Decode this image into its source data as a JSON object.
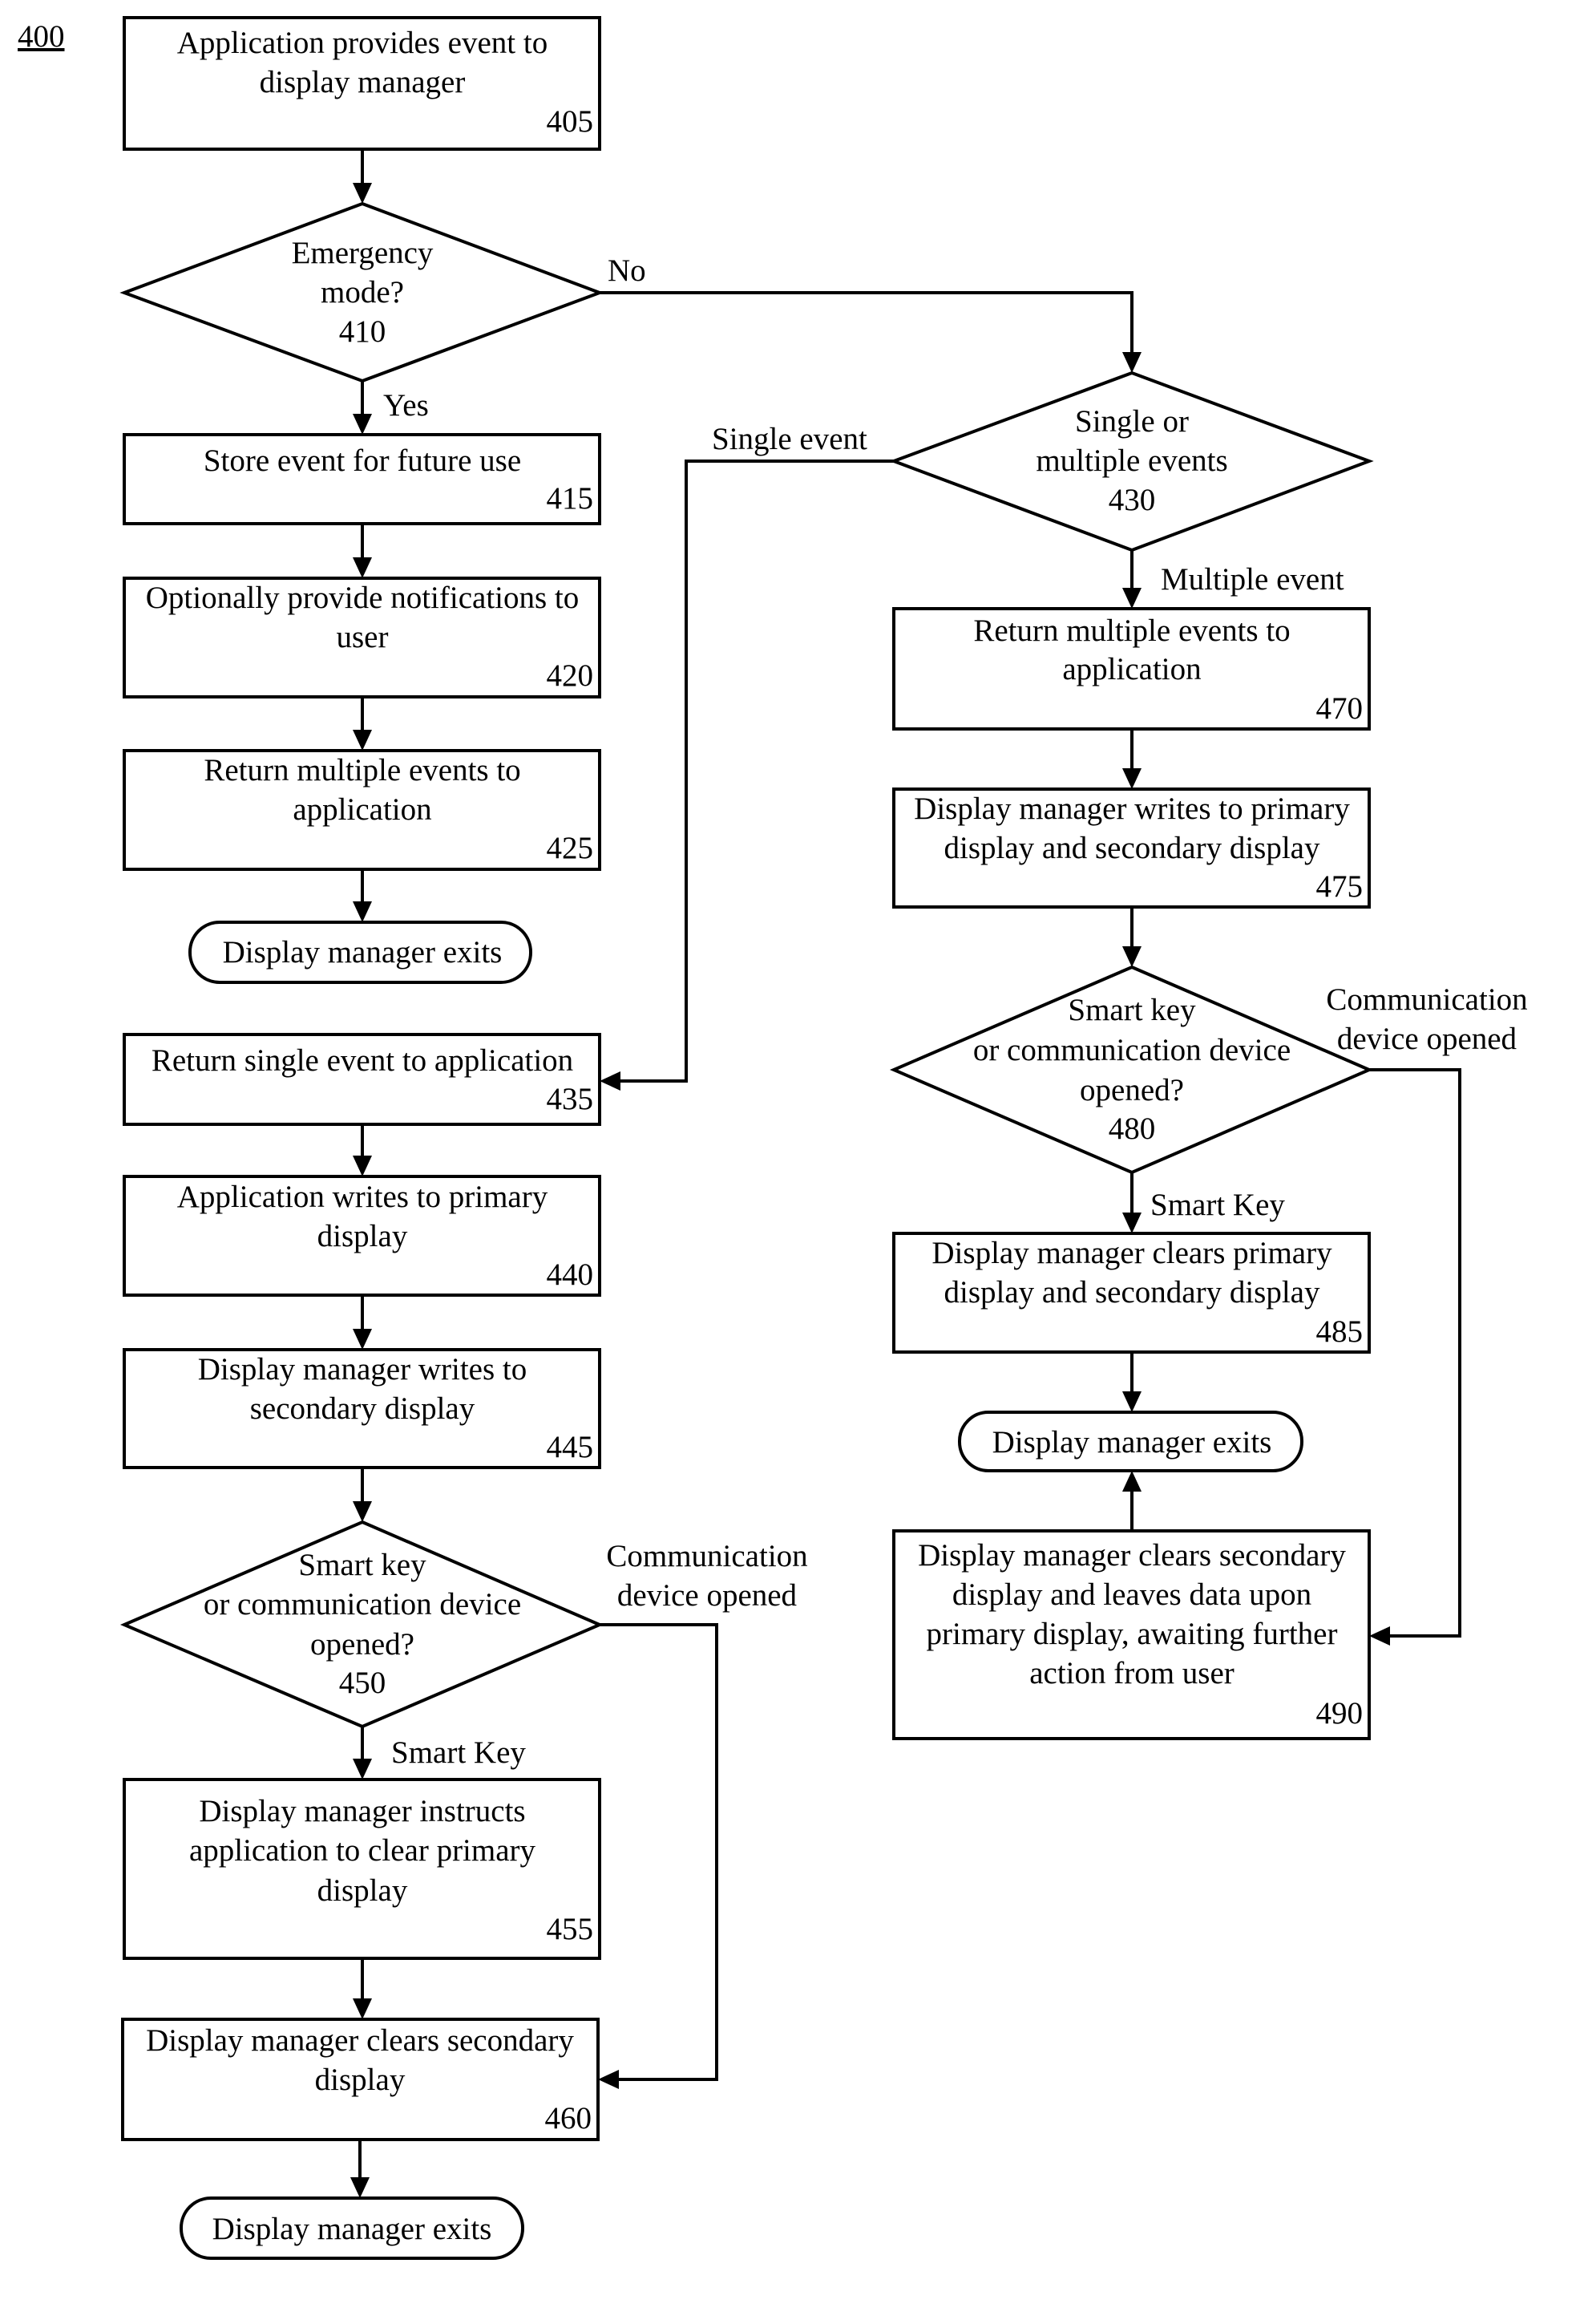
{
  "figure_label": "400",
  "nodes": {
    "n405": {
      "lines": [
        "Application provides event to",
        "display manager"
      ],
      "ref": "405"
    },
    "n410": {
      "lines": [
        "Emergency",
        "mode?"
      ],
      "ref": "410"
    },
    "n415": {
      "lines": [
        "Store event for future use"
      ],
      "ref": "415"
    },
    "n420": {
      "lines": [
        "Optionally provide notifications to",
        "user"
      ],
      "ref": "420"
    },
    "n425": {
      "lines": [
        "Return multiple events to",
        "application"
      ],
      "ref": "425"
    },
    "exit1": {
      "label": "Display manager exits"
    },
    "n435": {
      "lines": [
        "Return single event to application"
      ],
      "ref": "435"
    },
    "n440": {
      "lines": [
        "Application writes to primary",
        "display"
      ],
      "ref": "440"
    },
    "n445": {
      "lines": [
        "Display manager writes to",
        "secondary display"
      ],
      "ref": "445"
    },
    "n450": {
      "lines": [
        "Smart key",
        "or communication device",
        "opened?"
      ],
      "ref": "450"
    },
    "n455": {
      "lines": [
        "Display manager instructs",
        "application to clear primary",
        "display"
      ],
      "ref": "455"
    },
    "n460": {
      "lines": [
        "Display manager clears secondary",
        "display"
      ],
      "ref": "460"
    },
    "exit2": {
      "label": "Display manager exits"
    },
    "n430": {
      "lines": [
        "Single or",
        "multiple events"
      ],
      "ref": "430"
    },
    "n470": {
      "lines": [
        "Return multiple events to",
        "application"
      ],
      "ref": "470"
    },
    "n475": {
      "lines": [
        "Display manager writes to primary",
        "display and secondary display"
      ],
      "ref": "475"
    },
    "n480": {
      "lines": [
        "Smart key",
        "or communication device",
        "opened?"
      ],
      "ref": "480"
    },
    "n485": {
      "lines": [
        "Display manager clears primary",
        "display and secondary display"
      ],
      "ref": "485"
    },
    "exit3": {
      "label": "Display manager exits"
    },
    "n490": {
      "lines": [
        "Display manager clears secondary",
        "display and leaves data upon",
        "primary display, awaiting further",
        "action from user"
      ],
      "ref": "490"
    }
  },
  "edge_labels": {
    "no": "No",
    "yes": "Yes",
    "single_event": "Single event",
    "multiple_event": "Multiple event",
    "smart_key_left": "Smart Key",
    "comm_left": [
      "Communication",
      "device opened"
    ],
    "smart_key_right": "Smart Key",
    "comm_right": [
      "Communication",
      "device opened"
    ]
  }
}
